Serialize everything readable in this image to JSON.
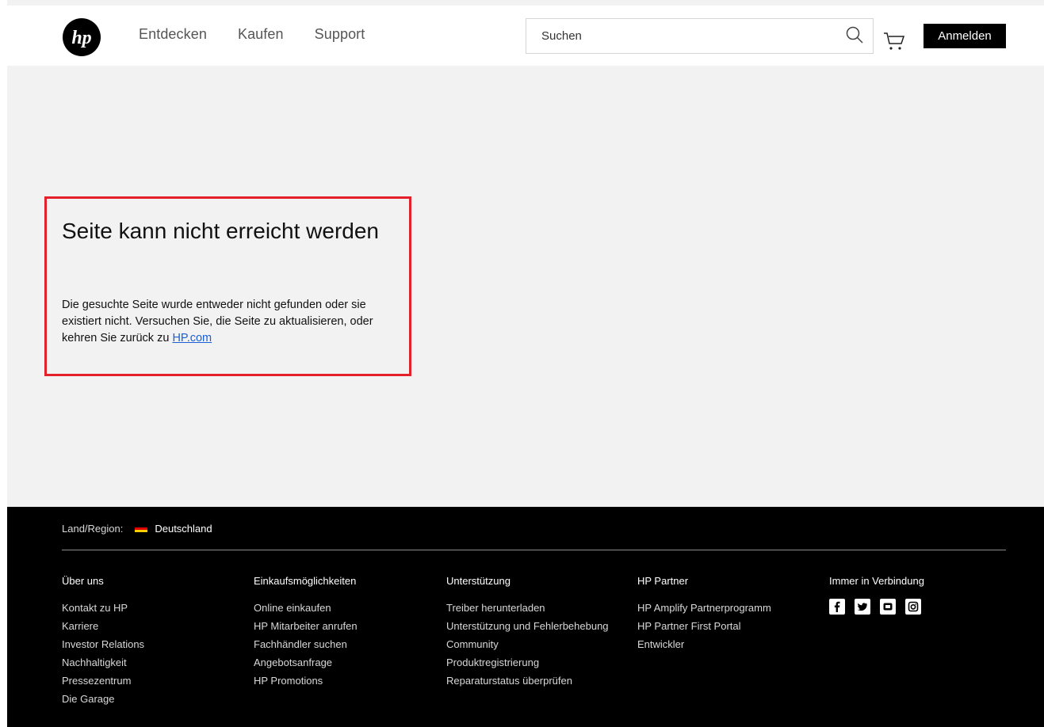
{
  "header": {
    "logo_text": "hp",
    "nav": [
      "Entdecken",
      "Kaufen",
      "Support"
    ],
    "search_placeholder": "Suchen",
    "signin_label": "Anmelden"
  },
  "error": {
    "title": "Seite kann nicht erreicht werden",
    "text": "Die gesuchte Seite wurde entweder nicht gefunden oder sie existiert nicht. Versuchen Sie, die Seite zu aktualisieren, oder kehren Sie zurück zu ",
    "link": "HP.com",
    "highlight_color": "#e4202a"
  },
  "footer": {
    "region_label": "Land/Region:",
    "country": "Deutschland",
    "columns": [
      {
        "title": "Über uns",
        "items": [
          "Kontakt zu HP",
          "Karriere",
          "Investor Relations",
          "Nachhaltigkeit",
          "Pressezentrum",
          "Die Garage"
        ]
      },
      {
        "title": "Einkaufsmöglichkeiten",
        "items": [
          "Online einkaufen",
          "HP Mitarbeiter anrufen",
          "Fachhändler suchen",
          "Angebotsanfrage",
          "HP Promotions"
        ]
      },
      {
        "title": "Unterstützung",
        "items": [
          "Treiber herunterladen",
          "Unterstützung und Fehlerbehebung",
          "Community",
          "Produktregistrierung",
          "Reparaturstatus überprüfen"
        ]
      },
      {
        "title": "HP Partner",
        "items": [
          "HP Amplify Partnerprogramm",
          "HP Partner First Portal",
          "Entwickler"
        ]
      },
      {
        "title": "Immer in Verbindung",
        "social": [
          "facebook-icon",
          "twitter-icon",
          "youtube-icon",
          "instagram-icon"
        ]
      }
    ]
  }
}
